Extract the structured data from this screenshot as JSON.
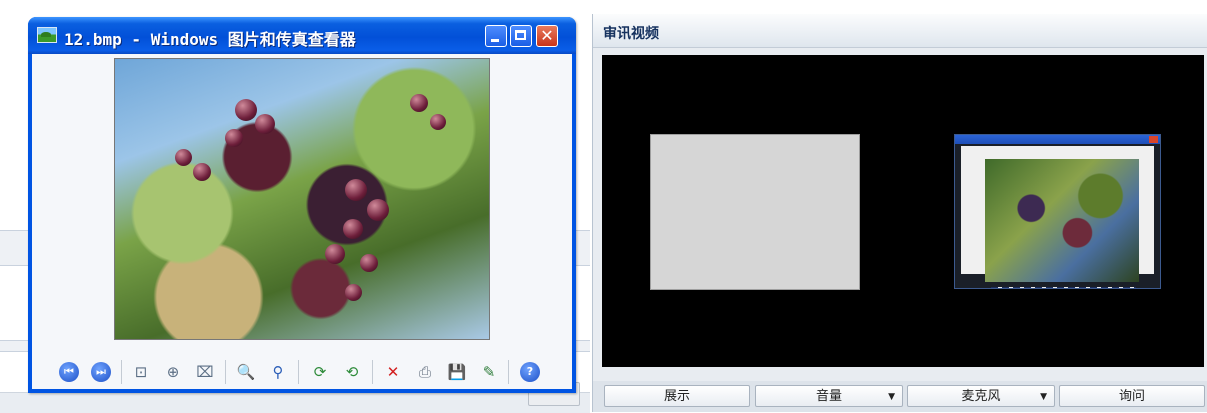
{
  "viewer": {
    "title": "12.bmp - Windows 图片和传真查看器",
    "icon": "picture-viewer-icon",
    "controls": {
      "min": "minimize-icon",
      "max": "maximize-icon",
      "close": "✕"
    },
    "toolbar": {
      "prev": "⏮",
      "next": "⏭",
      "best_fit": "⊡",
      "actual_size": "⊕",
      "slideshow": "⌧",
      "zoom_in": "🔍",
      "zoom_out": "⚲",
      "rotate_cw": "⟳",
      "rotate_ccw": "⟲",
      "delete": "✕",
      "print": "⎙",
      "save": "💾",
      "edit": "✎",
      "help": "?"
    }
  },
  "panel": {
    "title": "审讯视频",
    "buttons": {
      "display": "展示",
      "volume": "音量",
      "microphone": "麦克风",
      "question": "询问"
    },
    "dropdown_arrow": "▼"
  },
  "colors": {
    "title_blue": "#0054e3",
    "panel_title": "#15315e",
    "video_bg": "#000000"
  }
}
